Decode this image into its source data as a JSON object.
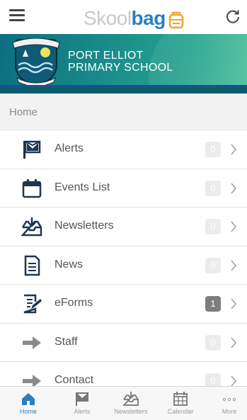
{
  "header": {
    "menu_icon": "hamburger-icon",
    "logo_part1": "Skool",
    "logo_part2": "bag",
    "refresh_icon": "refresh-icon"
  },
  "banner": {
    "school_line1": "PORT ELLIOT",
    "school_line2": "PRIMARY SCHOOL",
    "crest_text": "PORT ELLIOT PRIMARY SCHOOL"
  },
  "section": {
    "title": "Home"
  },
  "menu_items": [
    {
      "label": "Alerts",
      "icon": "flag-icon",
      "badge": "0",
      "active": false
    },
    {
      "label": "Events List",
      "icon": "calendar-icon",
      "badge": "0",
      "active": false
    },
    {
      "label": "Newsletters",
      "icon": "inbox-download-icon",
      "badge": "0",
      "active": false
    },
    {
      "label": "News",
      "icon": "document-icon",
      "badge": "0",
      "active": false
    },
    {
      "label": "eForms",
      "icon": "form-edit-icon",
      "badge": "1",
      "active": true
    },
    {
      "label": "Staff",
      "icon": "arrow-right-icon",
      "badge": "0",
      "active": false
    },
    {
      "label": "Contact",
      "icon": "arrow-right-icon",
      "badge": "0",
      "active": false
    }
  ],
  "tabbar": {
    "tabs": [
      {
        "label": "Home",
        "icon": "home-icon",
        "active": true
      },
      {
        "label": "Alerts",
        "icon": "flag-icon",
        "active": false
      },
      {
        "label": "Newsletters",
        "icon": "inbox-download-icon",
        "active": false
      },
      {
        "label": "Calendar",
        "icon": "calendar-grid-icon",
        "active": false
      },
      {
        "label": "More",
        "icon": "more-dots-icon",
        "active": false
      }
    ]
  },
  "colors": {
    "brand_blue": "#2a7fc0",
    "banner_teal": "#1a8d8a",
    "icon_dark": "#1f3550",
    "badge_active": "#7d7d7d"
  }
}
